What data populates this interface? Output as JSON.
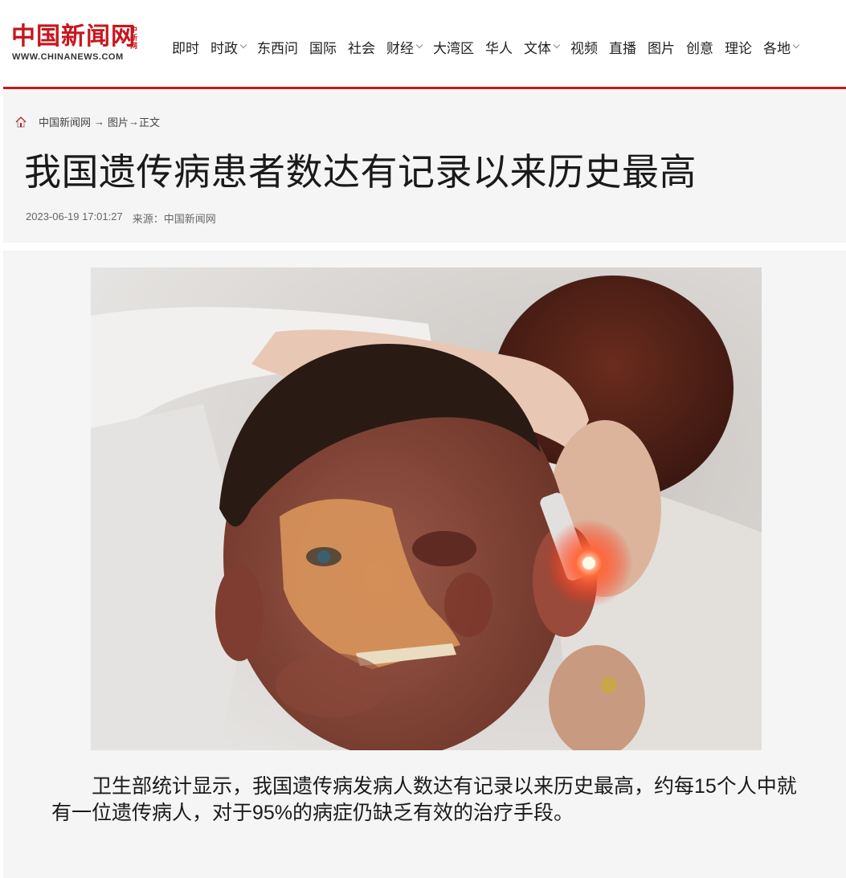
{
  "site": {
    "logo_cn": "中国新闻网",
    "logo_mini": "中新网",
    "logo_en": "WWW.CHINANEWS.COM",
    "brand_color": "#c8161d"
  },
  "nav": [
    {
      "label": "即时",
      "has_dropdown": false
    },
    {
      "label": "时政",
      "has_dropdown": true
    },
    {
      "label": "东西问",
      "has_dropdown": false
    },
    {
      "label": "国际",
      "has_dropdown": false
    },
    {
      "label": "社会",
      "has_dropdown": false
    },
    {
      "label": "财经",
      "has_dropdown": true
    },
    {
      "label": "大湾区",
      "has_dropdown": false
    },
    {
      "label": "华人",
      "has_dropdown": false
    },
    {
      "label": "文体",
      "has_dropdown": true
    },
    {
      "label": "视频",
      "has_dropdown": false
    },
    {
      "label": "直播",
      "has_dropdown": false
    },
    {
      "label": "图片",
      "has_dropdown": false
    },
    {
      "label": "创意",
      "has_dropdown": false
    },
    {
      "label": "理论",
      "has_dropdown": false
    },
    {
      "label": "各地",
      "has_dropdown": true
    }
  ],
  "breadcrumb": {
    "home": "中国新闻网",
    "sep1": "→",
    "section": "图片",
    "sep2": "→",
    "current": "正文"
  },
  "article": {
    "title": "我国遗传病患者数达有记录以来历史最高",
    "datetime": "2023-06-19 17:01:27",
    "source": "来源：中国新闻网",
    "caption": "卫生部统计显示，我国遗传病发病人数达有记录以来历史最高，约每15个人中就有一位遗传病人，对于95%的病症仍缺乏有效的治疗手段。"
  }
}
